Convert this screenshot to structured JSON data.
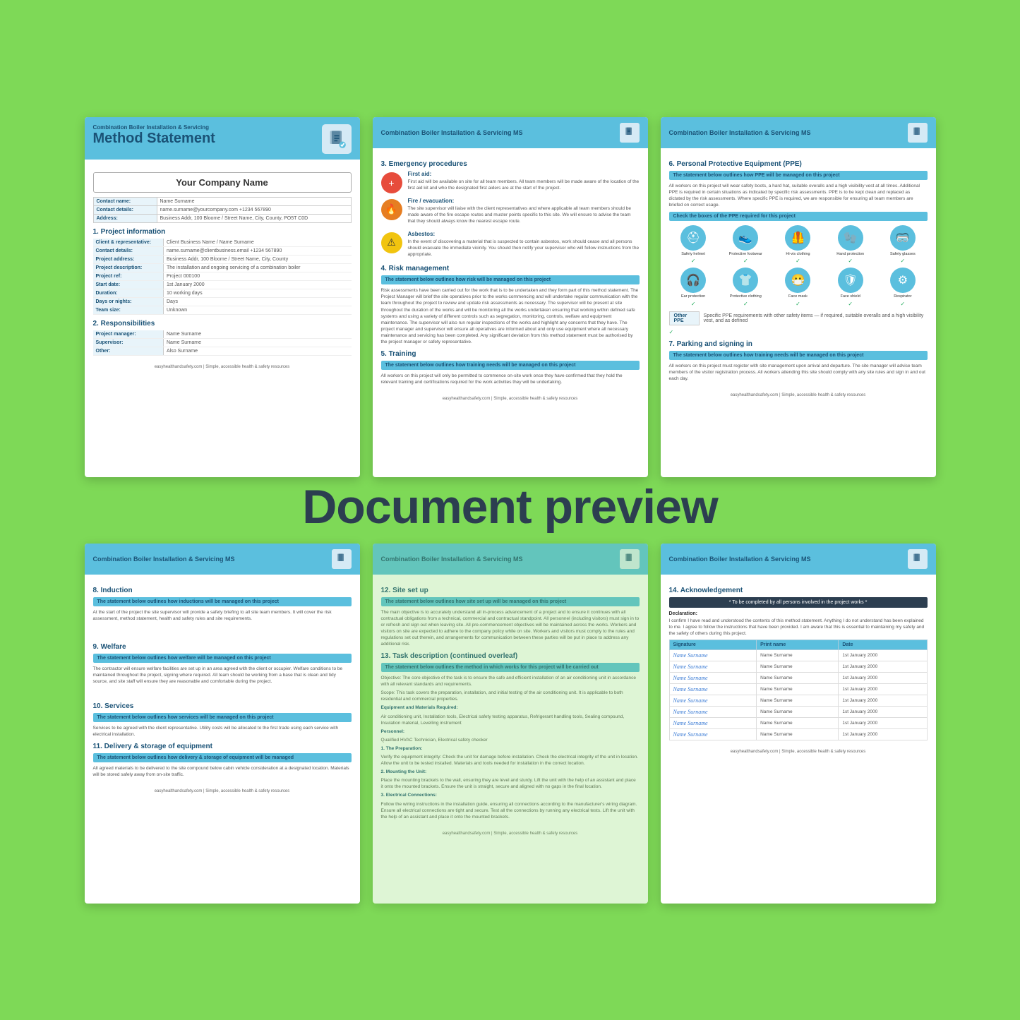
{
  "background_color": "#7ed957",
  "preview_label": "Document preview",
  "pages": {
    "page1": {
      "header_small": "Combination Boiler Installation & Servicing",
      "header_large": "Method Statement",
      "company_name": "Your Company Name",
      "contact_name_label": "Contact name:",
      "contact_details_label": "Contact details:",
      "address_label": "Address:",
      "contact_name_value": "Name Surname",
      "contact_details_value": "name.surname@yourcompany.com  +1234 567890",
      "address_value": "Business Addr, 100 Bloome / Street Name, City, County, PO5T C0D",
      "section1_title": "1. Project information",
      "fields": [
        {
          "label": "Client & representative:",
          "value": "Client Business Name  /  Name Surname"
        },
        {
          "label": "Contact details:",
          "value": "name.surname@clientbusiness.email  +1234 567890"
        },
        {
          "label": "Project address:",
          "value": "Business Addr, 100 Bloome / Street Name, City, County, PO5T C0D"
        },
        {
          "label": "Project description:",
          "value": "The installation and ongoing servicing of a combination boiler"
        },
        {
          "label": "Project ref:",
          "value": "Project 000100"
        },
        {
          "label": "Start date:",
          "value": "1st January 2000"
        },
        {
          "label": "Duration:",
          "value": "10 working days"
        },
        {
          "label": "Days or nights:",
          "value": "Days"
        },
        {
          "label": "Team size:",
          "value": "Unknown"
        }
      ],
      "section2_title": "2. Responsibilities",
      "responsibilities": [
        {
          "label": "Project manager:",
          "value": "Name Surname"
        },
        {
          "label": "Supervisor:",
          "value": "Name Surname"
        },
        {
          "label": "Other:",
          "value": "Also Surname"
        }
      ]
    },
    "page2": {
      "header": "Combination Boiler Installation & Servicing MS",
      "section3_title": "3. Emergency procedures",
      "first_aid_label": "First aid:",
      "first_aid_text": "First aid will be available on site for all team members. All team members will be made aware of the location of the first aid kit and who the designated first aiders are at the start of the project.",
      "fire_label": "Fire / evacuation:",
      "fire_text": "The site supervisor will liaise with the client representatives and where applicable all team members should be made aware of the fire escape routes and muster points specific to this site. We will ensure to advise the team that they should always know the nearest escape route.",
      "asbestos_label": "Asbestos:",
      "asbestos_text": "In the event of discovering a material that is suspected to contain asbestos, work should cease and all persons should evacuate the immediate vicinity. You should then notify your supervisor who will follow instructions from the appropriate.",
      "section4_title": "4. Risk management",
      "risk_banner": "The statement below outlines how risk will be managed on this project",
      "risk_text": "Risk assessments have been carried out for the work that is to be undertaken and they form part of this method statement. The Project Manager will brief the site operatives prior to the works commencing and will undertake regular communication with the team throughout the project to review and update risk assessments as necessary. The supervisor will be present at site throughout the duration of the works and will be monitoring all the works undertaken ensuring that working within defined safe systems and using a variety of different controls such as segregation, monitoring, controls, welfare and equipment maintenance. The supervisor will also run regular inspections of the works and highlight any concerns that they have. The project manager and supervisor will ensure all operatives are informed about and only use equipment where all necessary maintenance and servicing has been completed. Any significant deviation from this method statement must be authorised by the project manager or safety representative.",
      "section5_title": "5. Training",
      "training_banner": "The statement below outlines how training needs will be managed on this project",
      "training_text": "All workers on this project will only be permitted to commence on-site work once they have confirmed that they hold the relevant training and certifications required for the work activities they will be undertaking."
    },
    "page3": {
      "header": "Combination Boiler Installation & Servicing MS",
      "section6_title": "6. Personal Protective Equipment (PPE)",
      "ppe_banner1": "The statement below outlines how PPE will be managed on this project",
      "ppe_statement": "All workers on this project will wear safety boots, a hard hat, suitable overalls and a high visibility vest at all times. Additional PPE is required in certain situations as indicated by specific risk assessments. PPE is to be kept clean and replaced as dictated by the risk assessments. Where specific PPE is required, we are responsible for ensuring all team members are briefed on correct usage.",
      "ppe_check_banner": "Check the boxes of the PPE required for this project",
      "ppe_items": [
        {
          "name": "Safety helmet",
          "icon": "⛑",
          "checked": true
        },
        {
          "name": "Protective footwear",
          "icon": "👟",
          "checked": true
        },
        {
          "name": "Hi-vis clothing",
          "icon": "🦺",
          "checked": true
        },
        {
          "name": "Hand protection",
          "icon": "🧤",
          "checked": true
        },
        {
          "name": "Safety glasses",
          "icon": "🥽",
          "checked": true
        },
        {
          "name": "Ear protection",
          "icon": "🎧",
          "checked": true
        },
        {
          "name": "Protective clothing",
          "icon": "👕",
          "checked": true
        },
        {
          "name": "Face mask",
          "icon": "😷",
          "checked": true
        },
        {
          "name": "Face shield",
          "icon": "🛡",
          "checked": true
        },
        {
          "name": "Respirator",
          "icon": "⚙",
          "checked": true
        },
        {
          "name": "Other PPE",
          "icon": "✓",
          "checked": true
        }
      ],
      "section7_title": "7. Parking and signing in",
      "parking_banner": "The statement below outlines how training needs will be managed on this project",
      "parking_text": "All workers on this project must register with site management upon arrival and departure. The site manager will advise team members of the visitor registration process. All workers attending this site should comply with any site rules and sign in and out each day."
    },
    "page4": {
      "header": "Combination Boiler Installation & Servicing MS",
      "section8_title": "8. Induction",
      "induction_banner": "The statement below outlines how inductions will be managed on this project",
      "induction_text": "At the start of the project the site supervisor will provide a safety briefing to all site team members. It will cover the risk assessment, method statement, health and safety rules and site requirements.",
      "section9_title": "9. Welfare",
      "welfare_banner": "The statement below outlines how welfare will be managed on this project",
      "welfare_text": "The contractor will ensure welfare facilities are set up in an area agreed with the client or occupier. Welfare conditions to be maintained throughout the project, signing where required. All team should be working from a base that is clean and tidy source, and site staff will ensure they are reasonable and comfortable during the project.",
      "section10_title": "10. Services",
      "services_banner": "The statement below outlines how services will be managed on this project",
      "services_text": "Services to be agreed with the client representative. Utility costs will be allocated to the first trade using each service with electrical installation.",
      "section11_title": "11. Delivery & storage of equipment",
      "delivery_banner": "The statement below outlines how delivery & storage of equipment will be managed",
      "delivery_text": "All agreed materials to be delivered to the site compound below cabin vehicle consideration at a designated location. Materials will be stored safely away from on-site traffic."
    },
    "page5": {
      "header": "Combination Boiler Installation & Servicing MS",
      "section12_title": "12. Site set up",
      "setup_banner": "The statement below outlines how site set up will be managed on this project",
      "setup_text": "The main objective is to accurately understand all in-process advancement of a project and to ensure it continues with all contractual obligations from a technical, commercial and contractual standpoint. All personnel (including visitors) must sign in to or refresh and sign out when leaving site. All pre-commencement objectives will be maintained across the works. Workers and visitors on site are expected to adhere to the company policy while on site. Workers and visitors must comply to the rules and regulations set out therein, and arrangements for communication between these parties will be put in place to address any additional risk.",
      "section13_title": "13. Task description (continued overleaf)",
      "task_banner": "The statement below outlines the method in which works for this project will be carried out",
      "task_text": "Objective: The core objective of the task is to ensure the safe and efficient installation of an air conditioning unit in accordance with all relevant standards and requirements.",
      "task_scope": "Scope: This task covers the preparation, installation, and initial testing of the air conditioning unit. It is applicable to both residential and commercial properties.",
      "task_equipment_title": "Equipment and Materials Required:",
      "task_equipment": "Air conditioning unit, Installation tools, Electrical safety testing apparatus, Refrigerant handling tools, Sealing compound, Insulation material, Levelling instrument",
      "task_personnel_title": "Personnel:",
      "task_personnel": "Qualified HVAC Technician, Electrical safety checker",
      "task_steps_title": "1. The Preparation:",
      "task_steps": "Verify the equipment integrity: Check the unit for damage before installation. Check the electrical integrity of the unit in location. Allow the unit to be tested installed. Materials and tools needed for installation in the correct location.",
      "task_mount_title": "2. Mounting the Unit:",
      "task_mount": "Place the mounting brackets to the wall, ensuring they are level and sturdy. Lift the unit with the help of an assistant and place it onto the mounted brackets. Ensure the unit is straight, secure and aligned with no gaps in the final location.",
      "task_connect_title": "3. Electrical Connections:",
      "task_connect": "Follow the wiring instructions in the installation guide, ensuring all connections according to the manufacturer's wiring diagram. Ensure all electrical connections are tight and secure. Test all the connections by running any electrical tests. Lift the unit with the help of an assistant and place it onto the mounted brackets."
    },
    "page6": {
      "header": "Combination Boiler Installation & Servicing MS",
      "section14_title": "14. Acknowledgement",
      "dark_banner": "* To be completed by all persons involved in the project works *",
      "declaration_label": "Declaration:",
      "declaration_text": "I confirm I have read and understood the contents of this method statement. Anything I do not understand has been explained to me. I agree to follow the instructions that have been provided. I am aware that this is essential to maintaining my safety and the safety of others during this project.",
      "table_headers": [
        "Signature",
        "Print name",
        "Date"
      ],
      "signatures": [
        {
          "sig": "Name Surname",
          "print": "Name Surname",
          "date": "1st January 2000"
        },
        {
          "sig": "Name Surname",
          "print": "Name Surname",
          "date": "1st January 2000"
        },
        {
          "sig": "Name Surname",
          "print": "Name Surname",
          "date": "1st January 2000"
        },
        {
          "sig": "Name Surname",
          "print": "Name Surname",
          "date": "1st January 2000"
        },
        {
          "sig": "Name Surname",
          "print": "Name Surname",
          "date": "1st January 2000"
        },
        {
          "sig": "Name Surname",
          "print": "Name Surname",
          "date": "1st January 2000"
        },
        {
          "sig": "Name Surname",
          "print": "Name Surname",
          "date": "1st January 2000"
        },
        {
          "sig": "Name Surname",
          "print": "Name Surname",
          "date": "1st January 2000"
        }
      ]
    }
  },
  "footer_url": "easyhealthandsafety.com  |  Simple, accessible health & safety resources"
}
